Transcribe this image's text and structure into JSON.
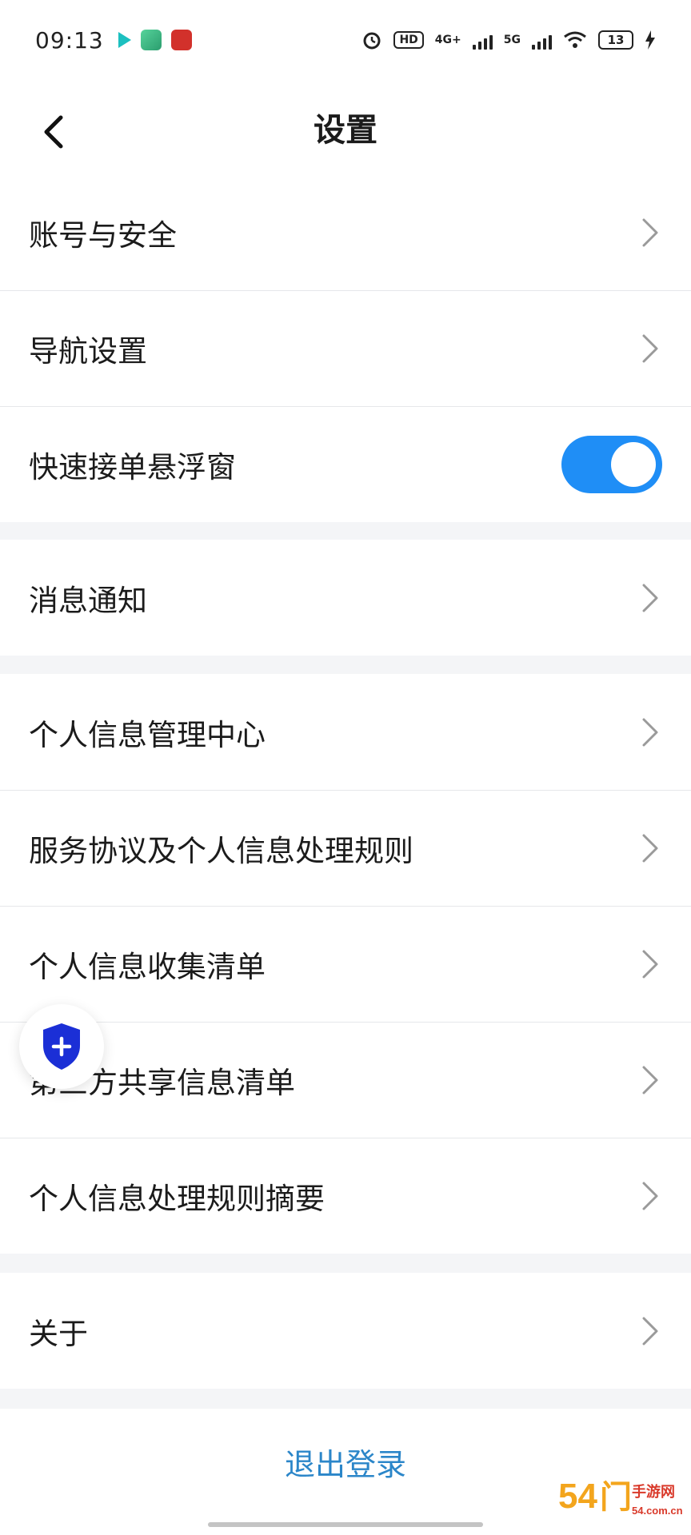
{
  "status_bar": {
    "time": "09:13",
    "hd_label": "HD",
    "net_4g": "4G+",
    "net_5g": "5G",
    "battery": "13"
  },
  "header": {
    "title": "设置"
  },
  "groups": [
    {
      "items": [
        {
          "label": "账号与安全",
          "control": "chevron"
        },
        {
          "label": "导航设置",
          "control": "chevron"
        },
        {
          "label": "快速接单悬浮窗",
          "control": "toggle",
          "toggle_on": true
        }
      ]
    },
    {
      "items": [
        {
          "label": "消息通知",
          "control": "chevron"
        }
      ]
    },
    {
      "items": [
        {
          "label": "个人信息管理中心",
          "control": "chevron"
        },
        {
          "label": "服务协议及个人信息处理规则",
          "control": "chevron"
        },
        {
          "label": "个人信息收集清单",
          "control": "chevron"
        },
        {
          "label": "第三方共享信息清单",
          "control": "chevron"
        },
        {
          "label": "个人信息处理规则摘要",
          "control": "chevron"
        }
      ]
    },
    {
      "items": [
        {
          "label": "关于",
          "control": "chevron"
        }
      ]
    }
  ],
  "footer": {
    "logout_label": "退出登录"
  },
  "watermark": {
    "text": "54门手游网",
    "sub": "54.com.cn"
  },
  "colors": {
    "accent_blue": "#1f8ef6",
    "logout_blue": "#2b86c9",
    "shield_blue": "#1b2fd6",
    "background": "#f4f5f7"
  },
  "icons": {
    "back": "chevron-left-icon",
    "row_arrow": "chevron-right-icon",
    "floating": "shield-plus-icon"
  }
}
